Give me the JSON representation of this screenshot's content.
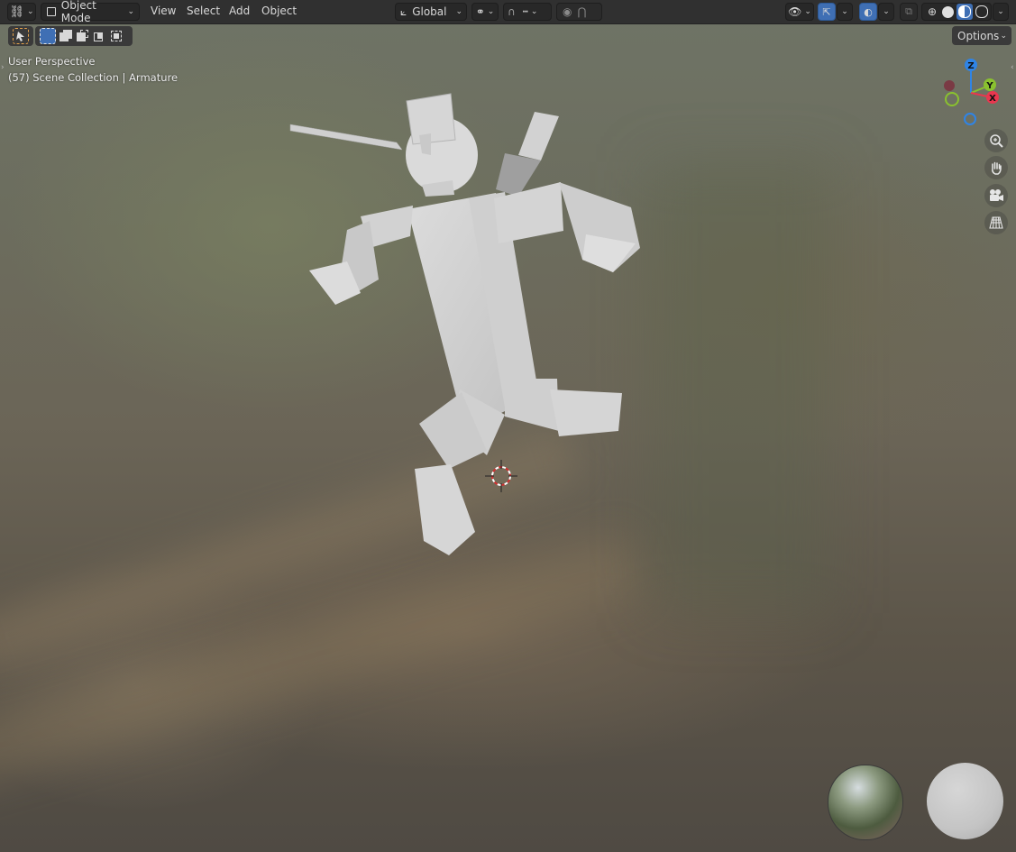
{
  "header": {
    "editor_type_icon": "transform-gizmo-icon",
    "mode": "Object Mode",
    "menus": [
      "View",
      "Select",
      "Add",
      "Object"
    ],
    "orientation": "Global",
    "snap_icon": "snap-icon",
    "proportional_icon": "proportional-editing-icon",
    "overlay_icon": "overlay-icon",
    "shading_modes": [
      "wireframe",
      "solid",
      "material-preview",
      "rendered"
    ],
    "active_shading": "material-preview"
  },
  "toolbar": {
    "select_tool_icon": "cursor-select-icon",
    "selection_modes": [
      "new",
      "extend",
      "subtract",
      "intersect",
      "invert"
    ],
    "options_label": "Options"
  },
  "viewport": {
    "view_name": "User Perspective",
    "collection_info": "(57) Scene Collection | Armature"
  },
  "gizmo": {
    "axes": {
      "x": "X",
      "y": "Y",
      "z": "Z"
    },
    "colors": {
      "x": "#e8374f",
      "y": "#8ac12f",
      "z": "#2f84e6"
    }
  },
  "nav_buttons": [
    "zoom-icon",
    "hand-pan-icon",
    "camera-icon",
    "grid-perspective-icon"
  ],
  "material_balls": [
    "hdri-sphere",
    "matcap-sphere"
  ]
}
